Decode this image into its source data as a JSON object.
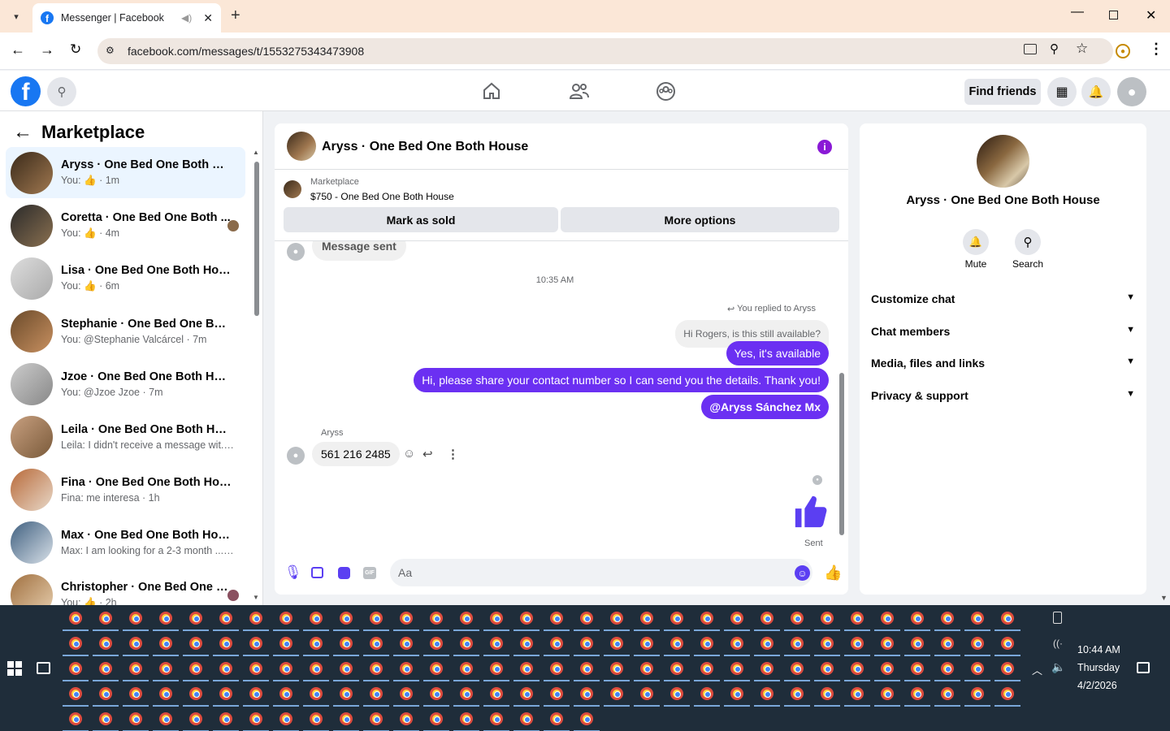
{
  "browser": {
    "tab_title": "Messenger | Facebook",
    "url": "facebook.com/messages/t/1553275343473908"
  },
  "header": {
    "find_friends": "Find friends"
  },
  "sidebar": {
    "title": "Marketplace",
    "conversations": [
      {
        "name": "Aryss · One Bed One Both House",
        "sub": "You: 👍 · 1m",
        "active": true
      },
      {
        "name": "Coretta · One Bed One Both ...",
        "sub": "You: 👍 · 4m"
      },
      {
        "name": "Lisa · One Bed One Both House",
        "sub": "You: 👍 · 6m"
      },
      {
        "name": "Stephanie · One Bed One Both ...",
        "sub": "You: @Stephanie Valcárcel · 7m"
      },
      {
        "name": "Jzoe · One Bed One Both House",
        "sub": "You: @Jzoe Jzoe · 7m"
      },
      {
        "name": "Leila · One Bed One Both House",
        "sub": "Leila: I didn't receive a message wit... · 1h"
      },
      {
        "name": "Fina · One Bed One Both House",
        "sub": "Fina: me interesa · 1h"
      },
      {
        "name": "Max · One Bed One Both House",
        "sub": "Max: I am looking for a 2-3 month ... · 2h"
      },
      {
        "name": "Christopher · One Bed One B...",
        "sub": "You: 👍 · 2h"
      }
    ]
  },
  "chat": {
    "title": "Aryss · One Bed One Both House",
    "listing_label": "Marketplace",
    "listing_title": "$750 - One Bed One Both House",
    "mark_sold": "Mark as sold",
    "more_options": "More options",
    "prev_message": "Message sent",
    "timestamp": "10:35 AM",
    "replied_label": "You replied to Aryss",
    "quoted": "Hi Rogers, is this still available?",
    "msg1": "Yes, it's available",
    "msg2": "Hi, please share your contact number so I can send you the details. Thank you!",
    "msg3": "@Aryss Sánchez Mx",
    "sender_name": "Aryss",
    "reply": "561 216 2485",
    "sent_label": "Sent",
    "input_placeholder": "Aa"
  },
  "info": {
    "name": "Aryss · One Bed One Both House",
    "mute": "Mute",
    "search": "Search",
    "sections": [
      "Customize chat",
      "Chat members",
      "Media, files and links",
      "Privacy & support"
    ]
  },
  "taskbar": {
    "time": "10:44 AM",
    "day": "Thursday",
    "date": "4/2/2026"
  },
  "colors": {
    "accent": "#6b30f2",
    "facebook_blue": "#1877f2",
    "taskbar": "#1f2d3a"
  }
}
